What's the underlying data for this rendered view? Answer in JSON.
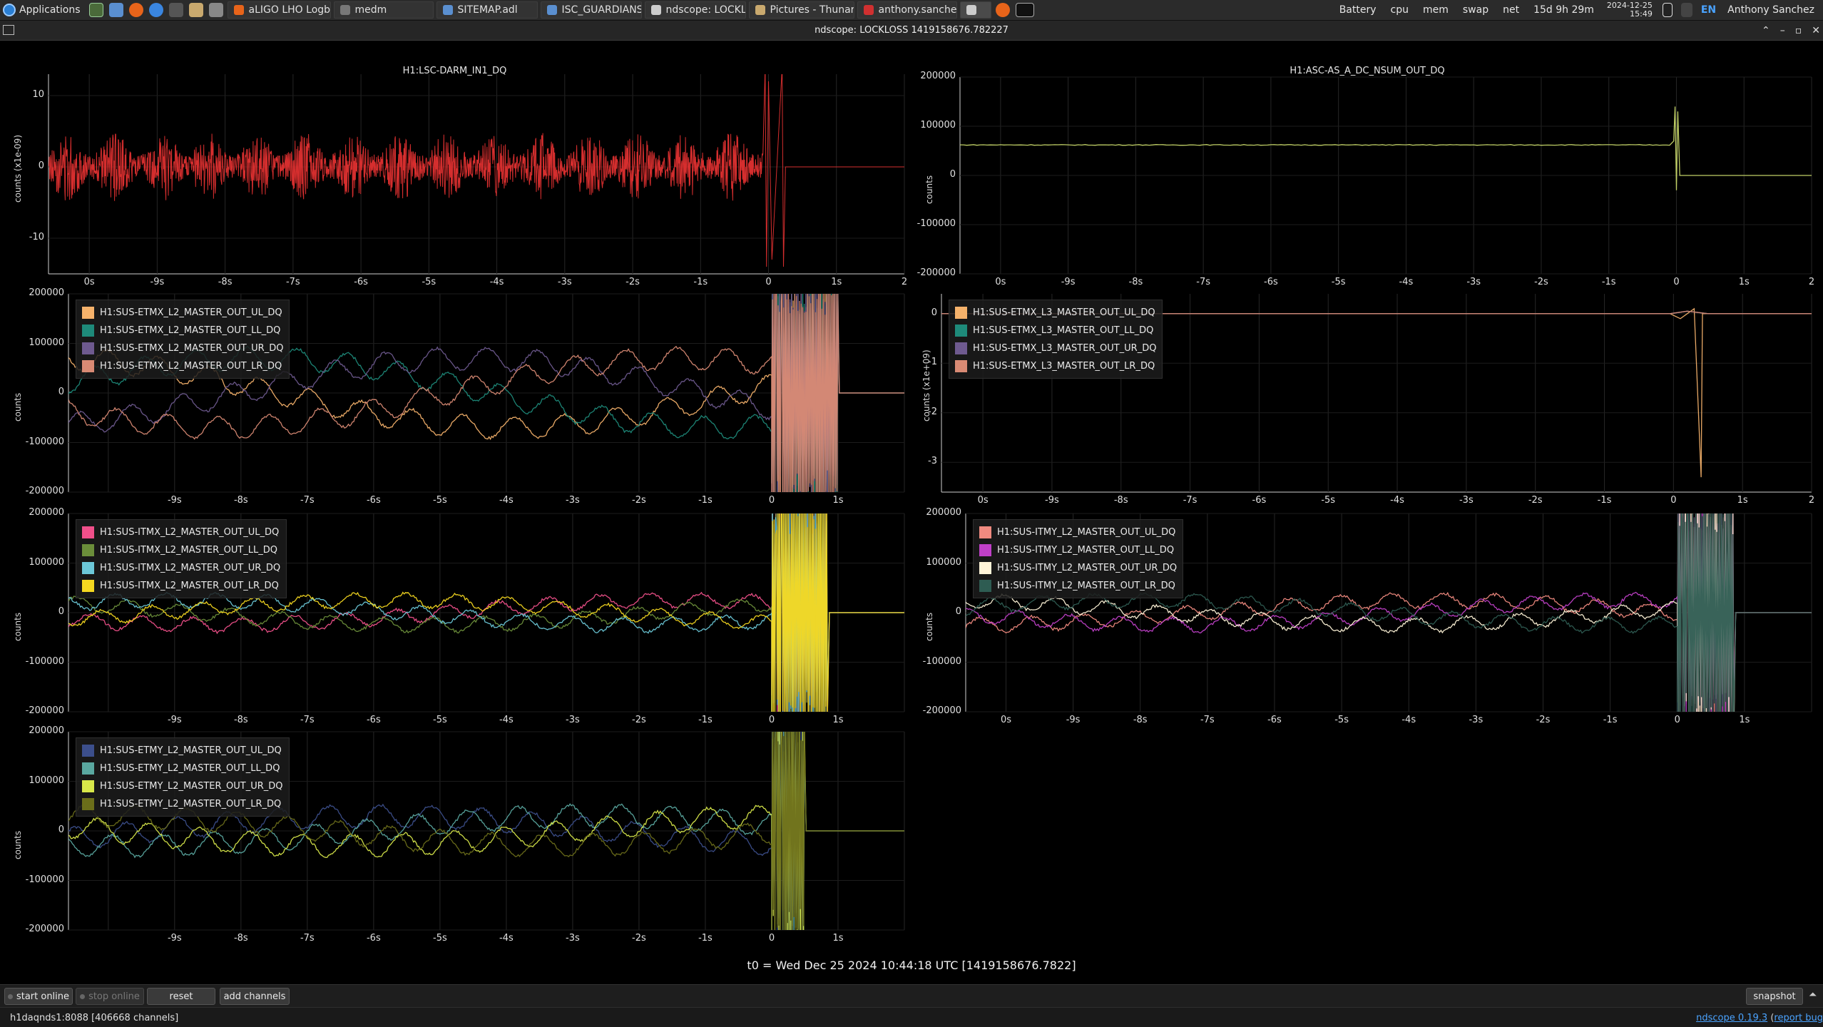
{
  "taskbar": {
    "apps_label": "Applications",
    "tasks": [
      {
        "label": "aLIGO LHO Logb...",
        "color": "#e8641a"
      },
      {
        "label": "medm",
        "color": "#777777"
      },
      {
        "label": "SITEMAP.adl",
        "color": "#5a8fd0"
      },
      {
        "label": "ISC_GUARDIANS...",
        "color": "#5a8fd0"
      },
      {
        "label": "ndscope: LOCKL...",
        "color": "#cccccc"
      },
      {
        "label": "Pictures - Thunar",
        "color": "#c9a96e"
      },
      {
        "label": "anthony.sanchez...",
        "color": "#d03030"
      }
    ],
    "tray": {
      "battery": "Battery",
      "cpu": "cpu",
      "mem": "mem",
      "swap": "swap",
      "net": "net",
      "uptime": "15d 9h 29m",
      "date": "2024-12-25",
      "time": "15:49",
      "lang": "EN",
      "user": "Anthony Sanchez"
    }
  },
  "window": {
    "title": "ndscope: LOCKLOSS 1419158676.782227"
  },
  "t0_label": "t0 = Wed Dec 25 2024 10:44:18 UTC [1419158676.7822]",
  "buttons": {
    "start_online": "start online",
    "stop_online": "stop online",
    "reset": "reset",
    "add_channels": "add channels",
    "snapshot": "snapshot"
  },
  "status": {
    "server": "h1daqnds1:8088  [406668 channels]",
    "version_prefix": "",
    "version_link": "ndscope 0.19.3",
    "report_bug": "report bug"
  },
  "plots": [
    {
      "id": "p1",
      "title": "H1:LSC-DARM_IN1_DQ",
      "ylabel": "counts (x1e-09)",
      "yticks": [
        "10",
        "0",
        "-10"
      ],
      "xticks": [
        "0s",
        "-9s",
        "-8s",
        "-7s",
        "-6s",
        "-5s",
        "-4s",
        "-3s",
        "-2s",
        "-1s",
        "0",
        "1s",
        "2"
      ],
      "legend": []
    },
    {
      "id": "p2",
      "title": "H1:ASC-AS_A_DC_NSUM_OUT_DQ",
      "ylabel": "counts",
      "yticks": [
        "200000",
        "100000",
        "0",
        "-100000",
        "-200000"
      ],
      "xticks": [
        "0s",
        "-9s",
        "-8s",
        "-7s",
        "-6s",
        "-5s",
        "-4s",
        "-3s",
        "-2s",
        "-1s",
        "0",
        "1s",
        "2"
      ],
      "legend": []
    },
    {
      "id": "p3",
      "title": "",
      "ylabel": "counts",
      "yticks": [
        "200000",
        "100000",
        "0",
        "-100000",
        "-200000"
      ],
      "xticks": [
        "-9s",
        "-8s",
        "-7s",
        "-6s",
        "-5s",
        "-4s",
        "-3s",
        "-2s",
        "-1s",
        "0",
        "1s"
      ],
      "legend": [
        {
          "name": "H1:SUS-ETMX_L2_MASTER_OUT_UL_DQ",
          "color": "#f5b26b"
        },
        {
          "name": "H1:SUS-ETMX_L2_MASTER_OUT_LL_DQ",
          "color": "#1e8a7a"
        },
        {
          "name": "H1:SUS-ETMX_L2_MASTER_OUT_UR_DQ",
          "color": "#6e5a8f"
        },
        {
          "name": "H1:SUS-ETMX_L2_MASTER_OUT_LR_DQ",
          "color": "#d98a74"
        }
      ]
    },
    {
      "id": "p4",
      "title": "",
      "ylabel": "counts (x1e+09)",
      "yticks": [
        "0",
        "-1",
        "-2",
        "-3"
      ],
      "xticks": [
        "0s",
        "-9s",
        "-8s",
        "-7s",
        "-6s",
        "-5s",
        "-4s",
        "-3s",
        "-2s",
        "-1s",
        "0",
        "1s",
        "2"
      ],
      "legend": [
        {
          "name": "H1:SUS-ETMX_L3_MASTER_OUT_UL_DQ",
          "color": "#f5b26b"
        },
        {
          "name": "H1:SUS-ETMX_L3_MASTER_OUT_LL_DQ",
          "color": "#1e8a7a"
        },
        {
          "name": "H1:SUS-ETMX_L3_MASTER_OUT_UR_DQ",
          "color": "#6e5a8f"
        },
        {
          "name": "H1:SUS-ETMX_L3_MASTER_OUT_LR_DQ",
          "color": "#d98a74"
        }
      ]
    },
    {
      "id": "p5",
      "title": "",
      "ylabel": "counts",
      "yticks": [
        "200000",
        "100000",
        "0",
        "-100000",
        "-200000"
      ],
      "xticks": [
        "-9s",
        "-8s",
        "-7s",
        "-6s",
        "-5s",
        "-4s",
        "-3s",
        "-2s",
        "-1s",
        "0",
        "1s"
      ],
      "legend": [
        {
          "name": "H1:SUS-ITMX_L2_MASTER_OUT_UL_DQ",
          "color": "#f0508a"
        },
        {
          "name": "H1:SUS-ITMX_L2_MASTER_OUT_LL_DQ",
          "color": "#6b8e3a"
        },
        {
          "name": "H1:SUS-ITMX_L2_MASTER_OUT_UR_DQ",
          "color": "#6cc8d8"
        },
        {
          "name": "H1:SUS-ITMX_L2_MASTER_OUT_LR_DQ",
          "color": "#f5d820"
        }
      ]
    },
    {
      "id": "p6",
      "title": "",
      "ylabel": "counts",
      "yticks": [
        "200000",
        "100000",
        "0",
        "-100000",
        "-200000"
      ],
      "xticks": [
        "0s",
        "-9s",
        "-8s",
        "-7s",
        "-6s",
        "-5s",
        "-4s",
        "-3s",
        "-2s",
        "-1s",
        "0",
        "1s"
      ],
      "legend": [
        {
          "name": "H1:SUS-ITMY_L2_MASTER_OUT_UL_DQ",
          "color": "#f08a80"
        },
        {
          "name": "H1:SUS-ITMY_L2_MASTER_OUT_LL_DQ",
          "color": "#c040c8"
        },
        {
          "name": "H1:SUS-ITMY_L2_MASTER_OUT_UR_DQ",
          "color": "#fff4d8"
        },
        {
          "name": "H1:SUS-ITMY_L2_MASTER_OUT_LR_DQ",
          "color": "#2e5c52"
        }
      ]
    },
    {
      "id": "p7",
      "title": "",
      "ylabel": "counts",
      "yticks": [
        "200000",
        "100000",
        "0",
        "-100000",
        "-200000"
      ],
      "xticks": [
        "-9s",
        "-8s",
        "-7s",
        "-6s",
        "-5s",
        "-4s",
        "-3s",
        "-2s",
        "-1s",
        "0",
        "1s"
      ],
      "legend": [
        {
          "name": "H1:SUS-ETMY_L2_MASTER_OUT_UL_DQ",
          "color": "#3c4f8c"
        },
        {
          "name": "H1:SUS-ETMY_L2_MASTER_OUT_LL_DQ",
          "color": "#5aa8a0"
        },
        {
          "name": "H1:SUS-ETMY_L2_MASTER_OUT_UR_DQ",
          "color": "#d8e84a"
        },
        {
          "name": "H1:SUS-ETMY_L2_MASTER_OUT_LR_DQ",
          "color": "#6b6e1a"
        }
      ]
    }
  ],
  "chart_data": [
    {
      "type": "line",
      "title": "H1:LSC-DARM_IN1_DQ",
      "ylabel": "counts (x1e-09)",
      "xlim": [
        -10,
        2
      ],
      "ylim": [
        -15,
        13
      ],
      "series": [
        {
          "name": "H1:LSC-DARM_IN1_DQ",
          "color": "#e03030",
          "x": [
            -10,
            -0.1,
            0,
            0.2,
            2
          ],
          "y": [
            0,
            0,
            14,
            -14,
            0
          ]
        }
      ]
    },
    {
      "type": "line",
      "title": "H1:ASC-AS_A_DC_NSUM_OUT_DQ",
      "ylabel": "counts",
      "xlim": [
        -10,
        2
      ],
      "ylim": [
        -200000,
        200000
      ],
      "series": [
        {
          "name": "H1:ASC-AS_A_DC_NSUM_OUT_DQ",
          "color": "#c8d86a",
          "x": [
            -10,
            -0.05,
            0,
            0.05,
            2
          ],
          "y": [
            62000,
            62000,
            140000,
            0,
            0
          ]
        }
      ]
    },
    {
      "type": "line",
      "ylabel": "counts",
      "xlim": [
        -10,
        2
      ],
      "ylim": [
        -200000,
        200000
      ],
      "series": [
        {
          "name": "H1:SUS-ETMX_L2_MASTER_OUT_UL_DQ",
          "color": "#f5b26b"
        },
        {
          "name": "H1:SUS-ETMX_L2_MASTER_OUT_LL_DQ",
          "color": "#1e8a7a"
        },
        {
          "name": "H1:SUS-ETMX_L2_MASTER_OUT_UR_DQ",
          "color": "#6e5a8f"
        },
        {
          "name": "H1:SUS-ETMX_L2_MASTER_OUT_LR_DQ",
          "color": "#d98a74"
        }
      ]
    },
    {
      "type": "line",
      "ylabel": "counts (x1e+09)",
      "xlim": [
        -10,
        2
      ],
      "ylim": [
        -3.6,
        0.4
      ],
      "series": [
        {
          "name": "H1:SUS-ETMX_L3_MASTER_OUT_UL_DQ",
          "color": "#f5b26b"
        },
        {
          "name": "H1:SUS-ETMX_L3_MASTER_OUT_LL_DQ",
          "color": "#1e8a7a"
        },
        {
          "name": "H1:SUS-ETMX_L3_MASTER_OUT_UR_DQ",
          "color": "#6e5a8f"
        },
        {
          "name": "H1:SUS-ETMX_L3_MASTER_OUT_LR_DQ",
          "color": "#d98a74"
        }
      ]
    },
    {
      "type": "line",
      "ylabel": "counts",
      "xlim": [
        -10,
        2
      ],
      "ylim": [
        -200000,
        200000
      ],
      "series": [
        {
          "name": "H1:SUS-ITMX_L2_MASTER_OUT_UL_DQ",
          "color": "#f0508a"
        },
        {
          "name": "H1:SUS-ITMX_L2_MASTER_OUT_LL_DQ",
          "color": "#6b8e3a"
        },
        {
          "name": "H1:SUS-ITMX_L2_MASTER_OUT_UR_DQ",
          "color": "#6cc8d8"
        },
        {
          "name": "H1:SUS-ITMX_L2_MASTER_OUT_LR_DQ",
          "color": "#f5d820"
        }
      ]
    },
    {
      "type": "line",
      "ylabel": "counts",
      "xlim": [
        -10,
        2
      ],
      "ylim": [
        -200000,
        200000
      ],
      "series": [
        {
          "name": "H1:SUS-ITMY_L2_MASTER_OUT_UL_DQ",
          "color": "#f08a80"
        },
        {
          "name": "H1:SUS-ITMY_L2_MASTER_OUT_LL_DQ",
          "color": "#c040c8"
        },
        {
          "name": "H1:SUS-ITMY_L2_MASTER_OUT_UR_DQ",
          "color": "#fff4d8"
        },
        {
          "name": "H1:SUS-ITMY_L2_MASTER_OUT_LR_DQ",
          "color": "#2e5c52"
        }
      ]
    },
    {
      "type": "line",
      "ylabel": "counts",
      "xlim": [
        -10,
        2
      ],
      "ylim": [
        -200000,
        200000
      ],
      "series": [
        {
          "name": "H1:SUS-ETMY_L2_MASTER_OUT_UL_DQ",
          "color": "#3c4f8c"
        },
        {
          "name": "H1:SUS-ETMY_L2_MASTER_OUT_LL_DQ",
          "color": "#5aa8a0"
        },
        {
          "name": "H1:SUS-ETMY_L2_MASTER_OUT_UR_DQ",
          "color": "#d8e84a"
        },
        {
          "name": "H1:SUS-ETMY_L2_MASTER_OUT_LR_DQ",
          "color": "#6b6e1a"
        }
      ]
    }
  ]
}
